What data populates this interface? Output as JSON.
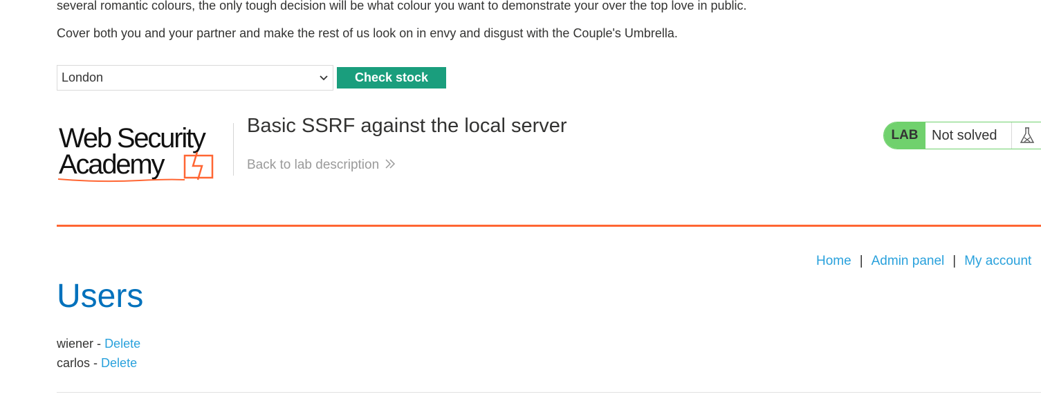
{
  "product": {
    "desc_line1": "several romantic colours, the only tough decision will be what colour you want to demonstrate your over the top love in public.",
    "desc_line2": "Cover both you and your partner and make the rest of us look on in envy and disgust with the Couple's Umbrella."
  },
  "stock": {
    "selected_store": "London",
    "check_label": "Check stock"
  },
  "header": {
    "logo_line1": "Web Security",
    "logo_line2": "Academy",
    "lab_title": "Basic SSRF against the local server",
    "back_link": "Back to lab description",
    "back_icon": "double-chevron-right-icon"
  },
  "lab_status": {
    "badge": "LAB",
    "status": "Not solved",
    "icon": "flask-icon"
  },
  "nav": {
    "home": "Home",
    "separator": "|",
    "admin": "Admin panel",
    "account": "My account"
  },
  "admin": {
    "heading": "Users",
    "delete_label": "Delete",
    "dash": "-",
    "users": [
      {
        "name": "wiener"
      },
      {
        "name": "carlos"
      }
    ]
  },
  "colors": {
    "accent_orange": "#ff6633",
    "button_green": "#1a9e7d",
    "link_blue": "#29a1dc",
    "heading_blue": "#0071bc",
    "lab_green": "#70d16d"
  }
}
